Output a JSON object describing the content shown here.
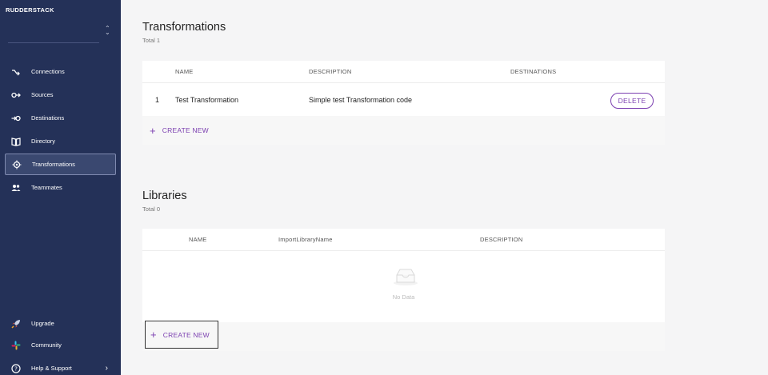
{
  "app": {
    "logo": "RUDDERSTACK",
    "workspace_value": ""
  },
  "sidebar": {
    "items": [
      {
        "label": "Connections",
        "icon": "connections-icon"
      },
      {
        "label": "Sources",
        "icon": "sources-icon"
      },
      {
        "label": "Destinations",
        "icon": "destinations-icon"
      },
      {
        "label": "Directory",
        "icon": "book-icon"
      },
      {
        "label": "Transformations",
        "icon": "transformations-icon",
        "active": true
      },
      {
        "label": "Teammates",
        "icon": "people-icon"
      }
    ],
    "bottom_items": [
      {
        "label": "Upgrade",
        "icon": "rocket-icon"
      },
      {
        "label": "Community",
        "icon": "slack-icon"
      },
      {
        "label": "Help & Support",
        "icon": "help-icon"
      }
    ]
  },
  "transformations": {
    "title": "Transformations",
    "total": "Total 1",
    "columns": [
      "NAME",
      "DESCRIPTION",
      "DESTINATIONS"
    ],
    "rows": [
      {
        "index": "1",
        "name": "Test Transformation",
        "description": "Simple test Transformation code",
        "destinations": "",
        "action": "DELETE"
      }
    ],
    "create_label": "CREATE NEW"
  },
  "libraries": {
    "title": "Libraries",
    "total": "Total 0",
    "columns": [
      "NAME",
      "ImportLibraryName",
      "DESCRIPTION"
    ],
    "empty_text": "No Data",
    "create_label": "CREATE NEW"
  },
  "colors": {
    "sidebar_bg": "#243158",
    "accent": "#7b3fb0",
    "page_bg": "#f5f5f6"
  }
}
